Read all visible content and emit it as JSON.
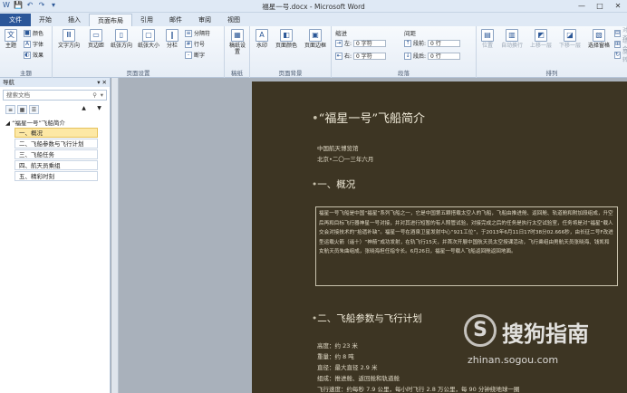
{
  "window": {
    "title": "福星一号.docx - Microsoft Word",
    "min": "—",
    "max": "□",
    "close": "✕"
  },
  "qat": [
    "W",
    "💾",
    "↶",
    "↷",
    "▾"
  ],
  "tabs": [
    {
      "label": "文件"
    },
    {
      "label": "开始"
    },
    {
      "label": "插入"
    },
    {
      "label": "页面布局"
    },
    {
      "label": "引用"
    },
    {
      "label": "邮件"
    },
    {
      "label": "审阅"
    },
    {
      "label": "视图"
    }
  ],
  "ribbon": {
    "theme": {
      "label": "主题",
      "main": "主题",
      "colors": "颜色",
      "fonts": "字体",
      "effects": "效果"
    },
    "page_setup": {
      "label": "页面设置",
      "text_direction": "文字方向",
      "margins": "页边距",
      "orientation": "纸张方向",
      "size": "纸张大小",
      "columns": "分栏",
      "breaks": "分隔符",
      "line_numbers": "行号",
      "hyphenation": "断字"
    },
    "draft": {
      "label": "稿纸",
      "btn": "稿纸设置"
    },
    "background": {
      "label": "页面背景",
      "watermark": "水印",
      "color": "页面颜色",
      "borders": "页面边框"
    },
    "paragraph": {
      "label": "段落",
      "indent": "缩进",
      "spacing": "间距",
      "left": "左:",
      "right": "右:",
      "before": "段前:",
      "after": "段后:",
      "left_val": "0 字符",
      "right_val": "0 字符",
      "before_val": "0 行",
      "after_val": "0 行"
    },
    "arrange": {
      "label": "排列",
      "position": "位置",
      "wrap": "自动换行",
      "forward": "上移一层",
      "backward": "下移一层",
      "pane": "选择窗格",
      "align": "对齐",
      "group": "组合",
      "rotate": "旋转"
    }
  },
  "nav": {
    "title": "导航",
    "search_placeholder": "搜索文档",
    "root": "“福星一号”飞船简介",
    "items": [
      "一、概况",
      "二、飞船参数与飞行计划",
      "三、飞船任务",
      "四、航天员乘组",
      "五、精彩时刻"
    ]
  },
  "doc": {
    "title": "“福星一号”飞船简介",
    "org": "中国航天博览馆",
    "date": "北京•二〇一三年六月",
    "h_overview": "一、概况",
    "overview": "福星一号飞船是中国“福星”系列飞船之一，它是中国第五颗搭载太空人的飞船，飞船由推进舱、返回舱、轨道舱和附加段组成，升空后再和目标飞行器神星一号对接，并对其进行短暂的有人照管试验，对接完成之后的任务是执行太空试验室，任务将是对“福星”载人交会对接技术的“拾遗补缺”。福星一号在酒泉卫星发射中心“921工位”，于2013年6月11日17时38分02.666秒，由长征二号F改进型运载火箭（遥十）“神箭”成功发射，在轨飞行15天，并首次开展中国航天员太空授课活动，飞行乘组由男航天员张晓海、钱凯和女航天员朱曲组成，张晓海担任指令长。6月26日，福星一号载人飞船返回舱返回地面。",
    "h_params": "二、飞船参数与飞行计划",
    "specs": [
      "高度：约 23 米",
      "重量：约 8 吨",
      "直径：最大直径 2.9 米",
      "组成：推进舱、返回舱和轨道舱",
      "飞行速度：约每秒 7.9 公里，每小时飞行 2.8 万公里，每 90 分钟绕地球一圈"
    ]
  },
  "watermark": {
    "logo": "S",
    "brand": "搜狗指南",
    "url": "zhinan.sogou.com"
  }
}
